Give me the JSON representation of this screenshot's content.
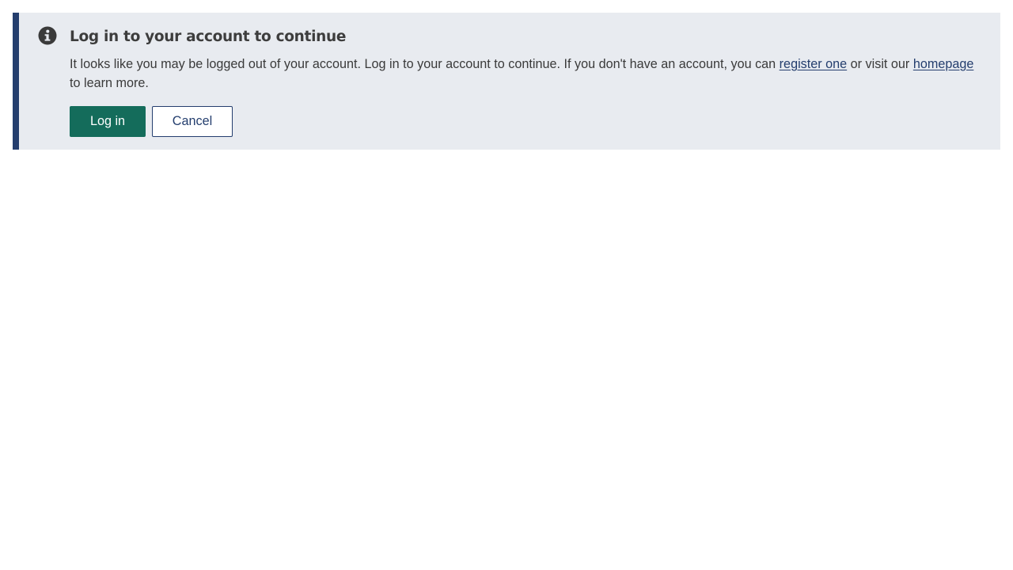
{
  "alert": {
    "icon": "info-circle-icon",
    "title": "Log in to your account to continue",
    "body_before": "It looks like you may be logged out of your account. Log in to your account to continue. If you don't have an account, you can ",
    "register_link": "register one",
    "body_middle": " or visit our ",
    "homepage_link": "homepage",
    "body_after": " to learn more.",
    "login_label": "Log in",
    "cancel_label": "Cancel"
  },
  "colors": {
    "accent_border": "#243e6e",
    "alert_background": "#e8ebf0",
    "primary_button": "#146c5b",
    "link": "#243e6e",
    "text": "#3a3a3a"
  }
}
